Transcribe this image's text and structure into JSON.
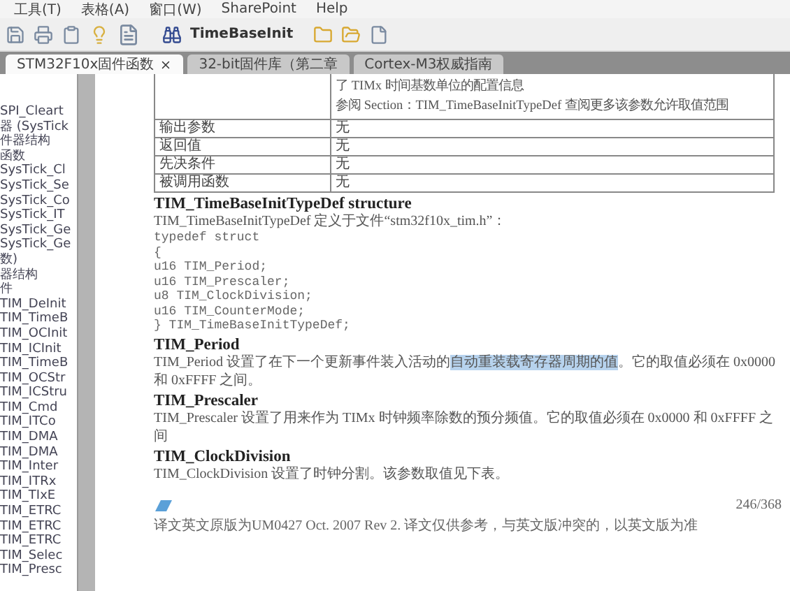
{
  "menu": [
    "工具(T)",
    "表格(A)",
    "窗口(W)",
    "SharePoint",
    "Help"
  ],
  "toolbar": {
    "search_value": "TimeBaseInit"
  },
  "tabs": [
    {
      "label": "STM32F10x固件函数",
      "selected": true,
      "closable": true
    },
    {
      "label": "32-bit固件库（第二章",
      "selected": false,
      "closable": false
    },
    {
      "label": "Cortex-M3权威指南",
      "selected": false,
      "closable": false
    }
  ],
  "tree": [
    "SPI_Cleart",
    "器 (SysTick",
    "件器结构",
    "函数",
    "SysTick_Cl",
    "SysTick_Se",
    "SysTick_Co",
    "SysTick_IT",
    "SysTick_Ge",
    "SysTick_Ge",
    "数)",
    "器结构",
    "件",
    "TIM_DeInit",
    "TIM_TimeB",
    "TIM_OCInit",
    "TIM_ICInit",
    "TIM_TimeB",
    "TIM_OCStr",
    "TIM_ICStru",
    "TIM_Cmd",
    "TIM_ITCo",
    "TIM_DMA",
    "TIM_DMA",
    "TIM_Inter",
    "TIM_ITRx",
    "TIM_TIxE",
    "TIM_ETRC",
    "TIM_ETRC",
    "TIM_ETRC",
    "TIM_Selec",
    "TIM_Presc"
  ],
  "table": {
    "first_row": [
      "了 TIMx 时间基数单位的配置信息",
      "参阅 Section：TIM_TimeBaseInitTypeDef 查阅更多该参数允许取值范围"
    ],
    "rows": [
      {
        "label": "输出参数",
        "value": "无"
      },
      {
        "label": "返回值",
        "value": "无"
      },
      {
        "label": "先决条件",
        "value": "无"
      },
      {
        "label": "被调用函数",
        "value": "无"
      }
    ]
  },
  "sections": [
    {
      "kind": "heading",
      "text": "TIM_TimeBaseInitTypeDef structure"
    },
    {
      "kind": "para",
      "parts": [
        {
          "text": "TIM_TimeBaseInitTypeDef 定义于文件“stm32f10x_tim.h”：",
          "highlighted": false
        }
      ]
    },
    {
      "kind": "code",
      "lines": [
        "typedef struct",
        "{",
        "u16 TIM_Period;",
        "u16 TIM_Prescaler;",
        "u8 TIM_ClockDivision;",
        "u16 TIM_CounterMode;",
        "} TIM_TimeBaseInitTypeDef;"
      ]
    },
    {
      "kind": "heading",
      "text": "TIM_Period"
    },
    {
      "kind": "para",
      "parts": [
        {
          "text": "TIM_Period 设置了在下一个更新事件装入活动的",
          "highlighted": false
        },
        {
          "text": "自动重装载寄存器周期的值",
          "highlighted": true
        },
        {
          "text": "。它的取值必须在 0x0000 和 0xFFFF 之间。",
          "highlighted": false
        }
      ]
    },
    {
      "kind": "heading",
      "text": "TIM_Prescaler"
    },
    {
      "kind": "para",
      "parts": [
        {
          "text": "TIM_Prescaler 设置了用来作为 TIMx 时钟频率除数的预分频值。它的取值必须在 0x0000 和 0xFFFF 之间",
          "highlighted": false
        }
      ]
    },
    {
      "kind": "heading",
      "text": "TIM_ClockDivision"
    },
    {
      "kind": "para",
      "parts": [
        {
          "text": "TIM_ClockDivision 设置了时钟分割。该参数取值见下表。",
          "highlighted": false
        }
      ]
    }
  ],
  "footer": {
    "page": "246/368",
    "note": "译文英文原版为UM0427 Oct. 2007 Rev 2. 译文仅供参考，与英文版冲突的，以英文版为准"
  }
}
